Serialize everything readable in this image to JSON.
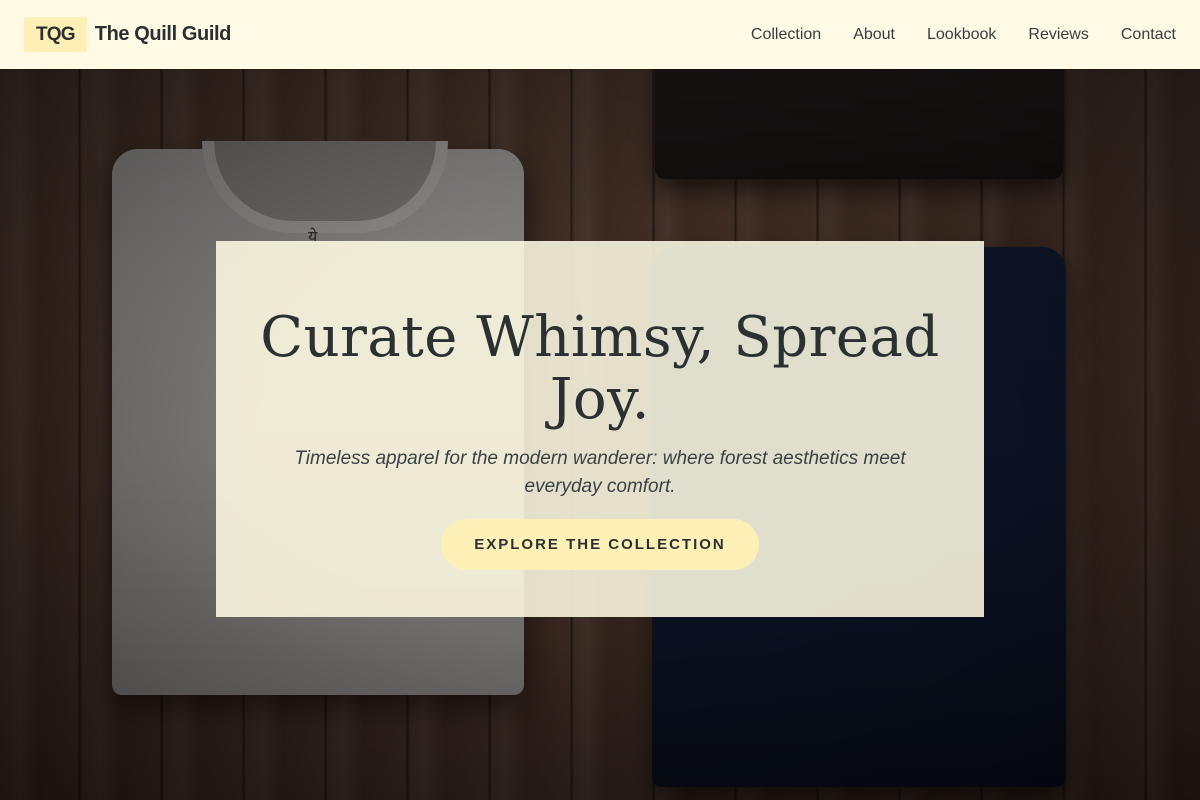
{
  "header": {
    "logo_mark": "TQG",
    "brand_name": "The Quill Guild",
    "nav": [
      {
        "label": "Collection"
      },
      {
        "label": "About"
      },
      {
        "label": "Lookbook"
      },
      {
        "label": "Reviews"
      },
      {
        "label": "Contact"
      }
    ]
  },
  "hero": {
    "title": "Curate Whimsy, Spread Joy.",
    "subtitle": "Timeless apparel for the modern wanderer: where forest aesthetics meet everyday comfort.",
    "cta_label": "EXPLORE THE COLLECTION",
    "shirt_tag_glyph": "ये"
  },
  "colors": {
    "header_bg": "#fefae6",
    "accent": "#fdf0b6",
    "text_dark": "#2b3033"
  }
}
